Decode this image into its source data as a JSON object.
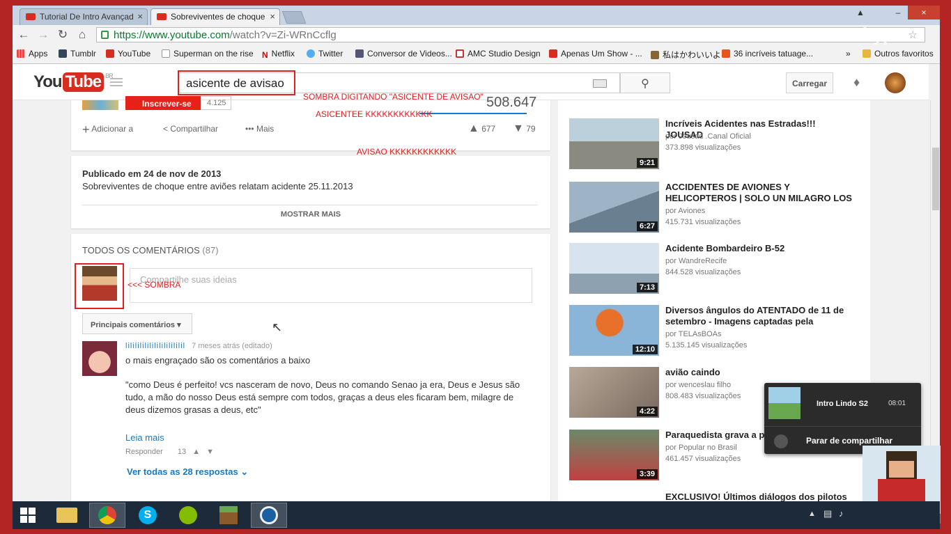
{
  "browser": {
    "tabs": [
      {
        "label": "Tutorial De Intro Avançad",
        "close": "×"
      },
      {
        "label": "Sobreviventes de choque",
        "close": "×"
      }
    ],
    "window_close": "×",
    "url_host": "https://www.youtube.com",
    "url_path": "/watch?v=Zi-WRnCcflg",
    "bookmarks": [
      "Apps",
      "Tumblr",
      "YouTube",
      "Superman on the rise",
      "Netflix",
      "Twitter",
      "Conversor de Videos...",
      "AMC Studio Design",
      "Apenas Um Show - ...",
      "私はかわいいよ",
      "36 incríveis tatuage...",
      "»",
      "Outros favoritos"
    ],
    "overlay_brand": "skype"
  },
  "youtube": {
    "logo_you": "You",
    "logo_tube": "Tube",
    "logo_region": "BR",
    "search_value": "asicente de avisao",
    "upload_label": "Carregar",
    "subscribe_label": "Inscrever-se",
    "subscribe_count": "4.125",
    "view_count": "508.647",
    "actions": {
      "add": "Adicionar a",
      "share": "Compartilhar",
      "more": "Mais"
    },
    "likes": "677",
    "dislikes": "79",
    "published": "Publicado em 24 de nov de 2013",
    "description": "Sobreviventes de choque entre aviões relatam acidente 25.11.2013",
    "show_more": "MOSTRAR MAIS",
    "comments_header": "TODOS OS COMENTÁRIOS",
    "comments_count": "(87)",
    "comment_placeholder": "Compartilhe suas ideias",
    "sort_label": "Principais comentários",
    "comment": {
      "author": "lilililililililililililil",
      "time": "7 meses atrás (editado)",
      "line1": "o mais engraçado são os comentários a baixo",
      "quote": "\"como Deus é perfeito! vcs nasceram de novo, Deus no comando Senao ja era, Deus e Jesus são tudo, a mão do nosso Deus está sempre com todos, graças a deus eles ficaram bem, milagre de deus dizemos grasas a deus, etc\"",
      "read_more": "Leia mais",
      "reply": "Responder",
      "reply_likes": "13",
      "view_all": "Ver todas as 28 respostas"
    },
    "related": [
      {
        "title": "Incríveis Acidentes nas Estradas!!! JOUSAD",
        "channel": "por Jousad .Canal Oficial",
        "views": "373.898 visualizações",
        "duration": "9:21"
      },
      {
        "title": "ACCIDENTES DE AVIONES Y HELICOPTEROS | SOLO UN MILAGRO LOS",
        "channel": "por Aviones",
        "views": "415.731 visualizações",
        "duration": "6:27"
      },
      {
        "title": "Acidente Bombardeiro B-52",
        "channel": "por WandreRecife",
        "views": "844.528 visualizações",
        "duration": "7:13"
      },
      {
        "title": "Diversos ângulos do ATENTADO de 11 de setembro - Imagens captadas pela",
        "channel": "por TELAsBOAs",
        "views": "5.135.145 visualizações",
        "duration": "12:10"
      },
      {
        "title": "avião caindo",
        "channel": "por wenceslau filho",
        "views": "808.483 visualizações",
        "duration": "4:22"
      },
      {
        "title": "Paraquedista grava a p",
        "channel": "por Popular no Brasil",
        "views": "461.457 visualizações",
        "duration": "3:39"
      },
      {
        "title": "EXCLUSIVO! Últimos diálogos dos pilotos",
        "channel": "",
        "views": "",
        "duration": ""
      }
    ]
  },
  "annotations": {
    "typing": "SOMBRA DIGITANDO \"ASICENTE DE AVISAO\"",
    "laugh1": "ASICENTEE KKKKKKKKKKKK",
    "laugh2": "AVISAO KKKKKKKKKKKK",
    "sombra": "<<< SOMBRA",
    "color": "#e02020"
  },
  "share_popup": {
    "title": "Intro Lindo  S2",
    "time": "08:01",
    "stop_label": "Parar de compartilhar"
  }
}
